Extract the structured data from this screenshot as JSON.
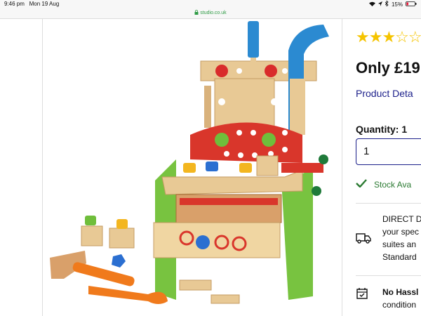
{
  "status_bar": {
    "time": "9:46 pm",
    "date": "Mon 19 Aug",
    "battery": "15%"
  },
  "browser": {
    "url": "studio.co.uk"
  },
  "product": {
    "rating_stars": "★★★☆☆",
    "price": "Only £19",
    "details_link": "Product Deta",
    "quantity_label": "Quantity: 1",
    "quantity_value": "1",
    "stock_text": "Stock Ava",
    "delivery_lines": [
      "DIRECT D",
      "your spec",
      "suites an"
    ],
    "delivery_standard": "Standard",
    "hassle_title": "No Hassl",
    "hassle_sub": "condition"
  },
  "colors": {
    "accent": "#1b1f8a",
    "stock": "#2b7a32",
    "star": "#f5c400"
  },
  "icons": {
    "secure": "lock-icon",
    "stock": "check-icon",
    "delivery": "truck-icon",
    "returns": "calendar-check-icon"
  }
}
